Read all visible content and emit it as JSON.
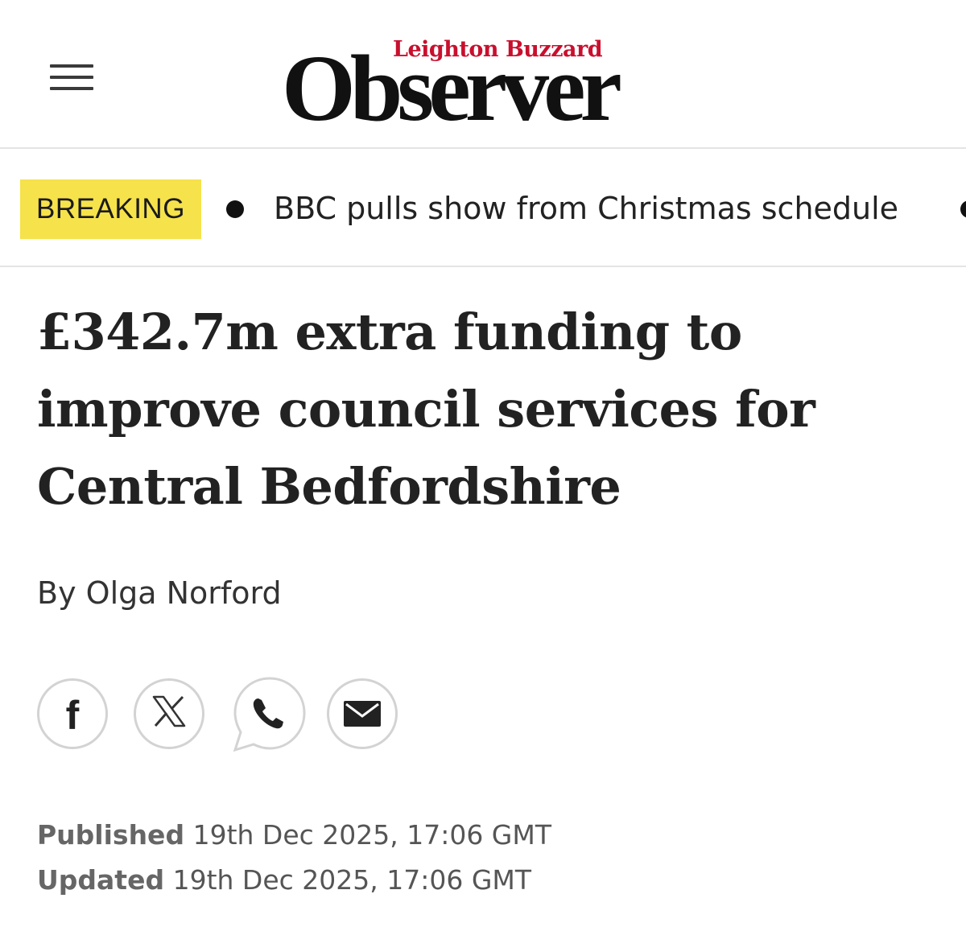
{
  "header": {
    "logo_sub": "Leighton Buzzard",
    "logo_main": "Observer"
  },
  "breaking": {
    "badge": "BREAKING",
    "headline": "BBC pulls show from Christmas schedule"
  },
  "article": {
    "title": "£342.7m extra funding to improve council services for Central Bedfordshire",
    "byline_prefix": "By",
    "author": "Olga Norford"
  },
  "share": {
    "facebook": "f",
    "x": "𝕏",
    "icons": [
      "facebook-icon",
      "x-icon",
      "whatsapp-icon",
      "email-icon"
    ]
  },
  "dates": {
    "published_label": "Published",
    "published_value": "19th Dec 2025, 17:06 GMT",
    "updated_label": "Updated",
    "updated_value": "19th Dec 2025, 17:06 GMT"
  },
  "colors": {
    "brand_red": "#c8102e",
    "breaking_yellow": "#f6e24b",
    "text_dark": "#222222"
  }
}
